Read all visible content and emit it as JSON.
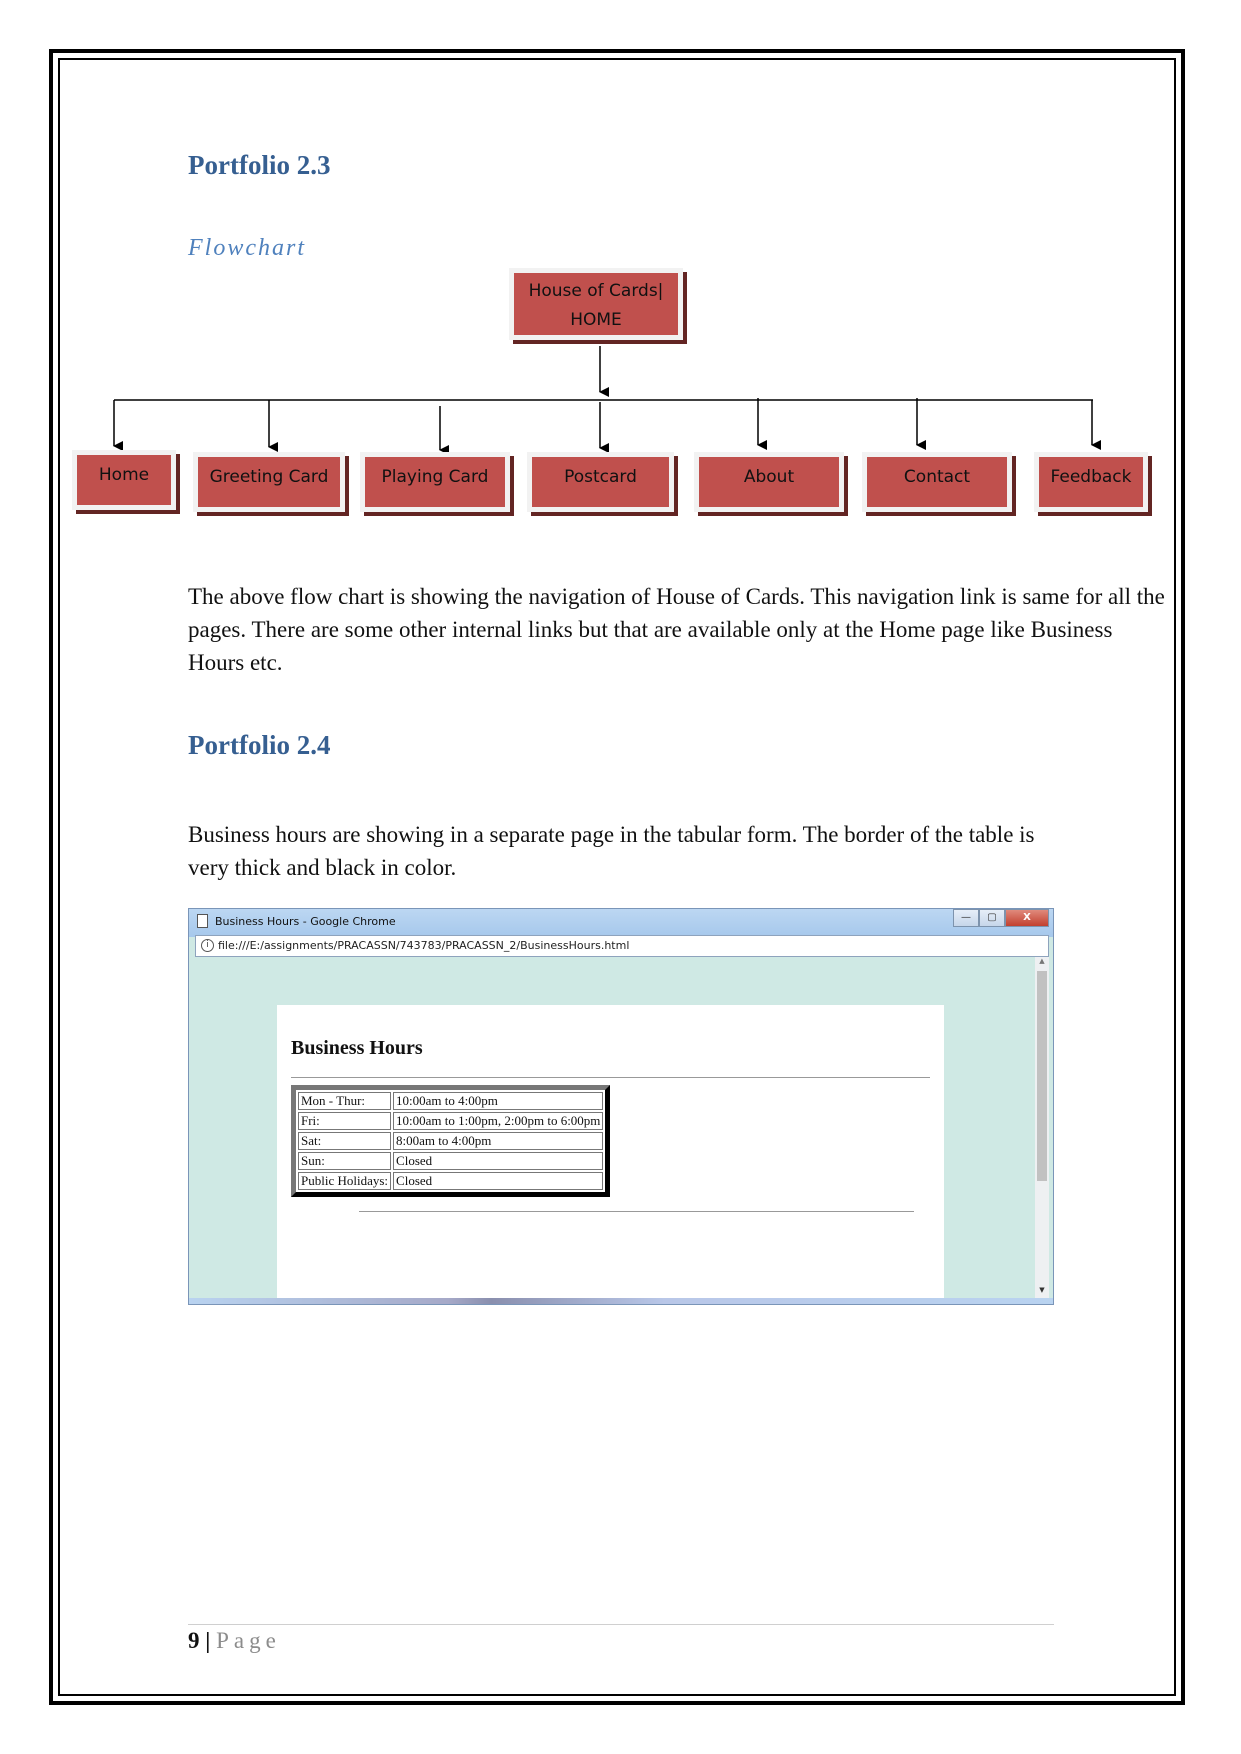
{
  "sections": {
    "portfolio_23": {
      "heading": "Portfolio 2.3",
      "subheading": "Flowchart",
      "paragraph": "The above flow chart is showing the navigation of House of Cards. This navigation link is same for all the pages. There are some other internal links but that are available only at the Home page like Business Hours etc."
    },
    "portfolio_24": {
      "heading": "Portfolio 2.4",
      "paragraph": "Business hours are showing in a separate page in the tabular form. The border of the table is very thick and black in color."
    }
  },
  "flowchart": {
    "root": "House of Cards| HOME",
    "children": [
      "Home",
      "Greeting Card",
      "Playing Card",
      "Postcard",
      "About",
      "Contact",
      "Feedback"
    ],
    "node_color": "#c0504d"
  },
  "browser": {
    "window_title": "Business Hours - Google Chrome",
    "url": "file:///E:/assignments/PRACASSN/743783/PRACASSN_2/BusinessHours.html",
    "controls": {
      "minimize": "—",
      "maximize": "▢",
      "close": "X"
    },
    "page": {
      "title": "Business Hours",
      "table": [
        [
          "Mon - Thur:",
          "10:00am to 4:00pm"
        ],
        [
          "Fri:",
          "10:00am to 1:00pm, 2:00pm to 6:00pm"
        ],
        [
          "Sat:",
          "8:00am to 4:00pm"
        ],
        [
          "Sun:",
          "Closed"
        ],
        [
          "Public Holidays:",
          "Closed"
        ]
      ]
    }
  },
  "footer": {
    "page_number": "9",
    "separator": "|",
    "page_label": "Page"
  }
}
